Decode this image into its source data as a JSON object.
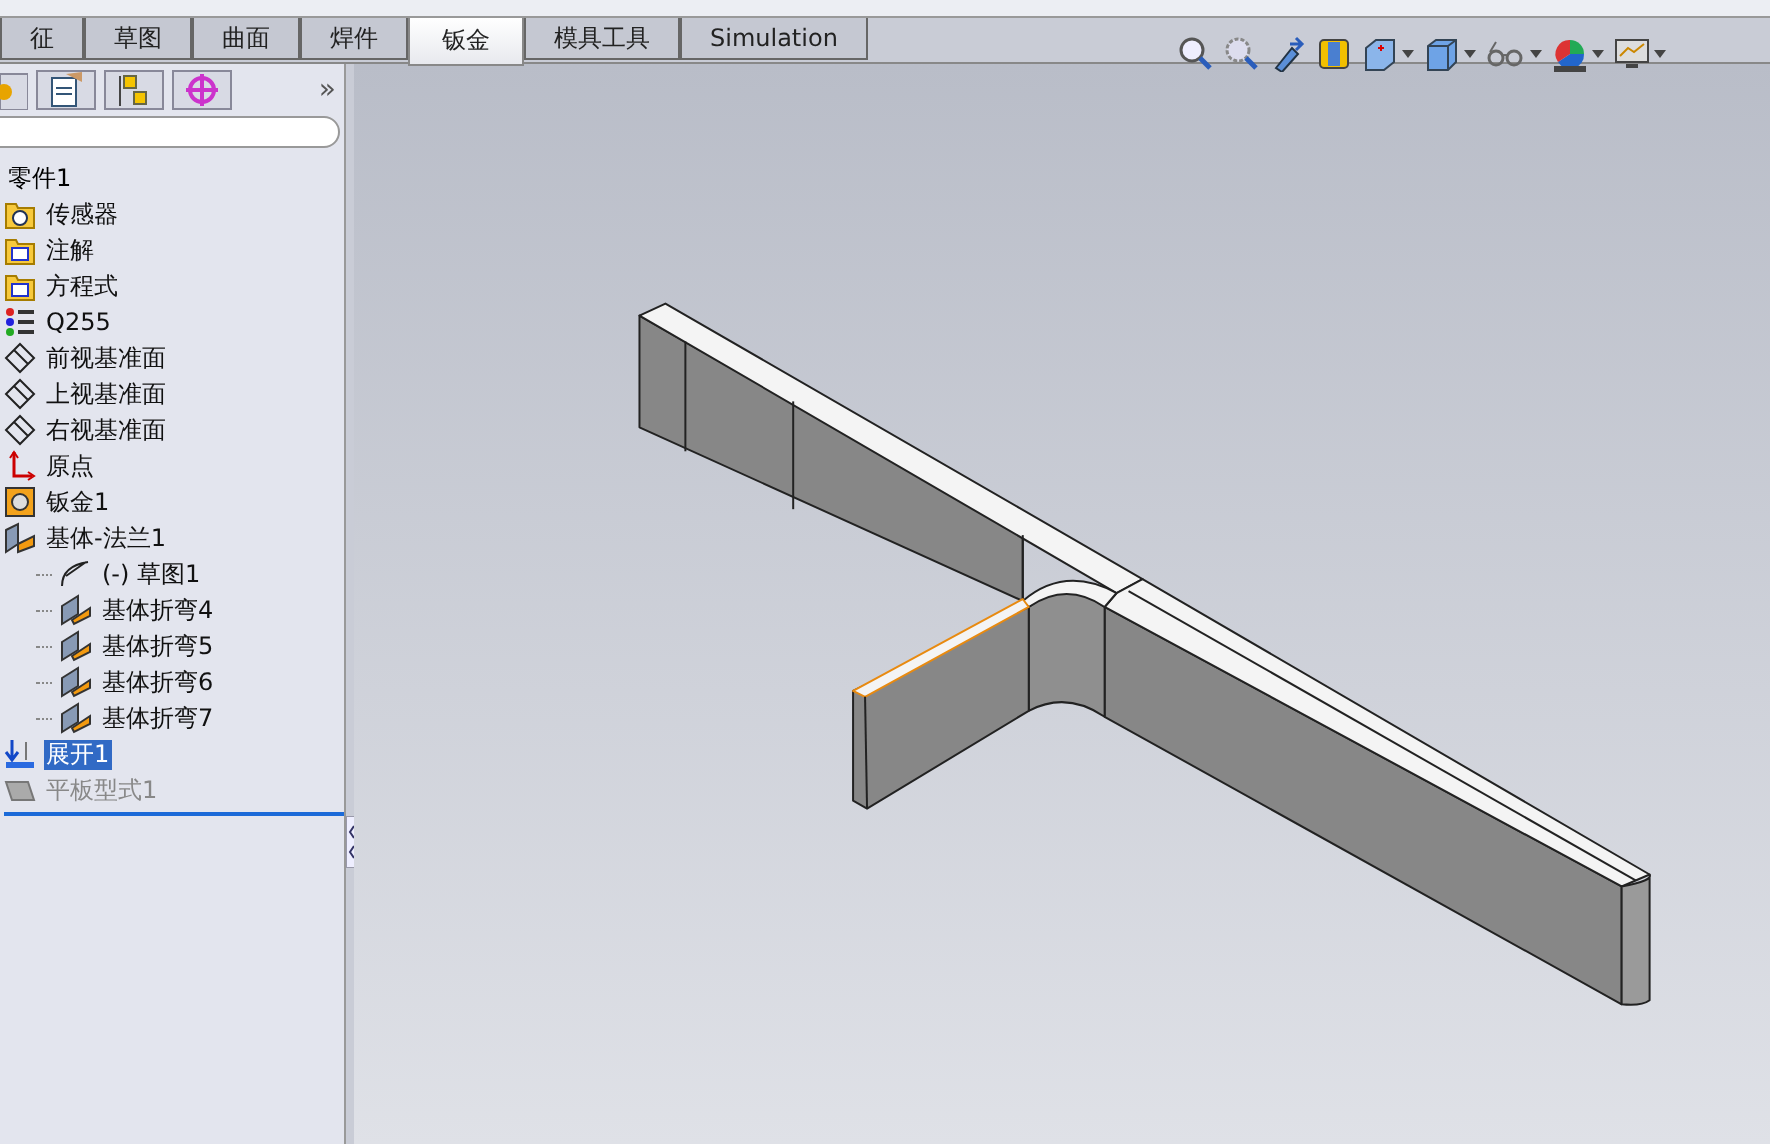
{
  "tabs": [
    {
      "label": "征",
      "selected": false
    },
    {
      "label": "草图",
      "selected": false
    },
    {
      "label": "曲面",
      "selected": false
    },
    {
      "label": "焊件",
      "selected": false
    },
    {
      "label": "钣金",
      "selected": true
    },
    {
      "label": "模具工具",
      "selected": false
    },
    {
      "label": "Simulation",
      "selected": false
    }
  ],
  "panel": {
    "more": "»"
  },
  "tree": {
    "root": "零件1",
    "items": [
      {
        "label": "传感器",
        "kind": "sensors",
        "selected": false,
        "disabled": false
      },
      {
        "label": "注解",
        "kind": "annotations",
        "selected": false,
        "disabled": false
      },
      {
        "label": "方程式",
        "kind": "equations",
        "selected": false,
        "disabled": false
      },
      {
        "label": "Q255",
        "kind": "material",
        "selected": false,
        "disabled": false
      },
      {
        "label": "前视基准面",
        "kind": "plane",
        "selected": false,
        "disabled": false
      },
      {
        "label": "上视基准面",
        "kind": "plane",
        "selected": false,
        "disabled": false
      },
      {
        "label": "右视基准面",
        "kind": "plane",
        "selected": false,
        "disabled": false
      },
      {
        "label": "原点",
        "kind": "origin",
        "selected": false,
        "disabled": false
      },
      {
        "label": "钣金1",
        "kind": "sheetmetal",
        "selected": false,
        "disabled": false
      },
      {
        "label": "基体-法兰1",
        "kind": "flange",
        "selected": false,
        "disabled": false,
        "children": [
          {
            "label": "(-) 草图1",
            "kind": "sketch",
            "selected": false,
            "disabled": false
          },
          {
            "label": "基体折弯4",
            "kind": "bend",
            "selected": false,
            "disabled": false
          },
          {
            "label": "基体折弯5",
            "kind": "bend",
            "selected": false,
            "disabled": false
          },
          {
            "label": "基体折弯6",
            "kind": "bend",
            "selected": false,
            "disabled": false
          },
          {
            "label": "基体折弯7",
            "kind": "bend",
            "selected": false,
            "disabled": false
          }
        ]
      },
      {
        "label": "展开1",
        "kind": "unfold",
        "selected": true,
        "disabled": false
      },
      {
        "label": "平板型式1",
        "kind": "flat",
        "selected": false,
        "disabled": true
      }
    ]
  }
}
